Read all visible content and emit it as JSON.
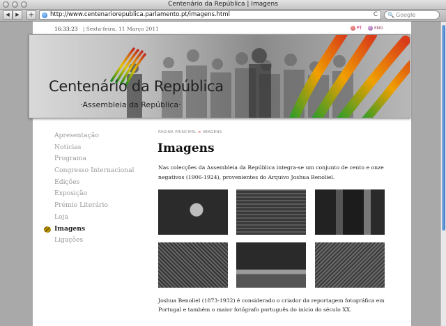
{
  "window": {
    "title": "Centenário da República | Imagens"
  },
  "browser": {
    "url": "http://www.centenariorepublica.parlamento.pt/imagens.html",
    "search_placeholder": "Google",
    "back_label": "◀",
    "forward_label": "▶",
    "add_label": "+",
    "reload_label": "C"
  },
  "header": {
    "time": "16:33:23",
    "date": "| Sexta-feira, 11 Março 2011",
    "lang_pt": "PT",
    "lang_en": "ENG"
  },
  "banner": {
    "title": "Centenário da República",
    "subtitle": "·Assembleia da República·"
  },
  "sidebar": {
    "items": [
      {
        "label": "Apresentação"
      },
      {
        "label": "Notícias"
      },
      {
        "label": "Programa"
      },
      {
        "label": "Congresso Internacional"
      },
      {
        "label": "Edições"
      },
      {
        "label": "Exposição"
      },
      {
        "label": "Prémio Literário"
      },
      {
        "label": "Loja"
      },
      {
        "label": "Imagens",
        "active": true
      },
      {
        "label": "Ligações"
      }
    ]
  },
  "breadcrumb": {
    "home": "PÁGINA PRINCIPAL",
    "separator": ">",
    "current": "IMAGENS"
  },
  "main": {
    "title": "Imagens",
    "intro": "Nas colecções da Assembleia da República integra-se um conjunto de cento e onze negativos (1906-1924), provenientes do Arquivo Joshua Benoliel.",
    "bio_line1": "Joshua Benoliel (1873-1932) é considerado o criador da reportagem fotográfica em Portugal e também o maior fotógrafo português do início do século XX."
  },
  "colors": {
    "accent_green": "#2f8f1f",
    "accent_yellow": "#e2c200",
    "accent_red": "#c0302a",
    "sidebar_inactive": "#999999"
  }
}
